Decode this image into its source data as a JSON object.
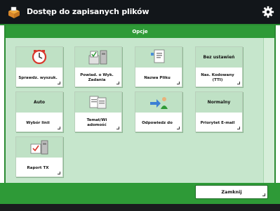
{
  "window": {
    "title": "Dostęp do zapisanych plików",
    "icon": "folder-box-icon"
  },
  "settings_icon": "gear-icon",
  "options_header": "Opcje",
  "tiles": [
    {
      "label": "Sprawdz. wyszuk.",
      "icon": "clock-icon"
    },
    {
      "label": "Powiad. o Wyk. Zadania",
      "icon": "notify-job-icon"
    },
    {
      "label": "Nazwa Pliku",
      "icon": "file-name-icon"
    },
    {
      "label": "Nas. Kodowany (TTI)",
      "header": "Bez ustawień",
      "icon": ""
    },
    {
      "label": "Wybór linii",
      "header": "Auto",
      "icon": ""
    },
    {
      "label": "Temat/Wi adomość",
      "icon": "document-message-icon"
    },
    {
      "label": "Odpowiedz do",
      "icon": "reply-to-icon"
    },
    {
      "label": "Priorytet E-mail",
      "header": "Normalny",
      "icon": ""
    },
    {
      "label": "Raport TX",
      "icon": "tx-report-icon"
    }
  ],
  "footer": {
    "close_label": "Zamknij"
  },
  "colors": {
    "accent_green": "#2e9a37",
    "panel_green": "#c6e6cc",
    "tile_icon_bg": "#bfe1c5",
    "title_bar": "#12161a"
  }
}
